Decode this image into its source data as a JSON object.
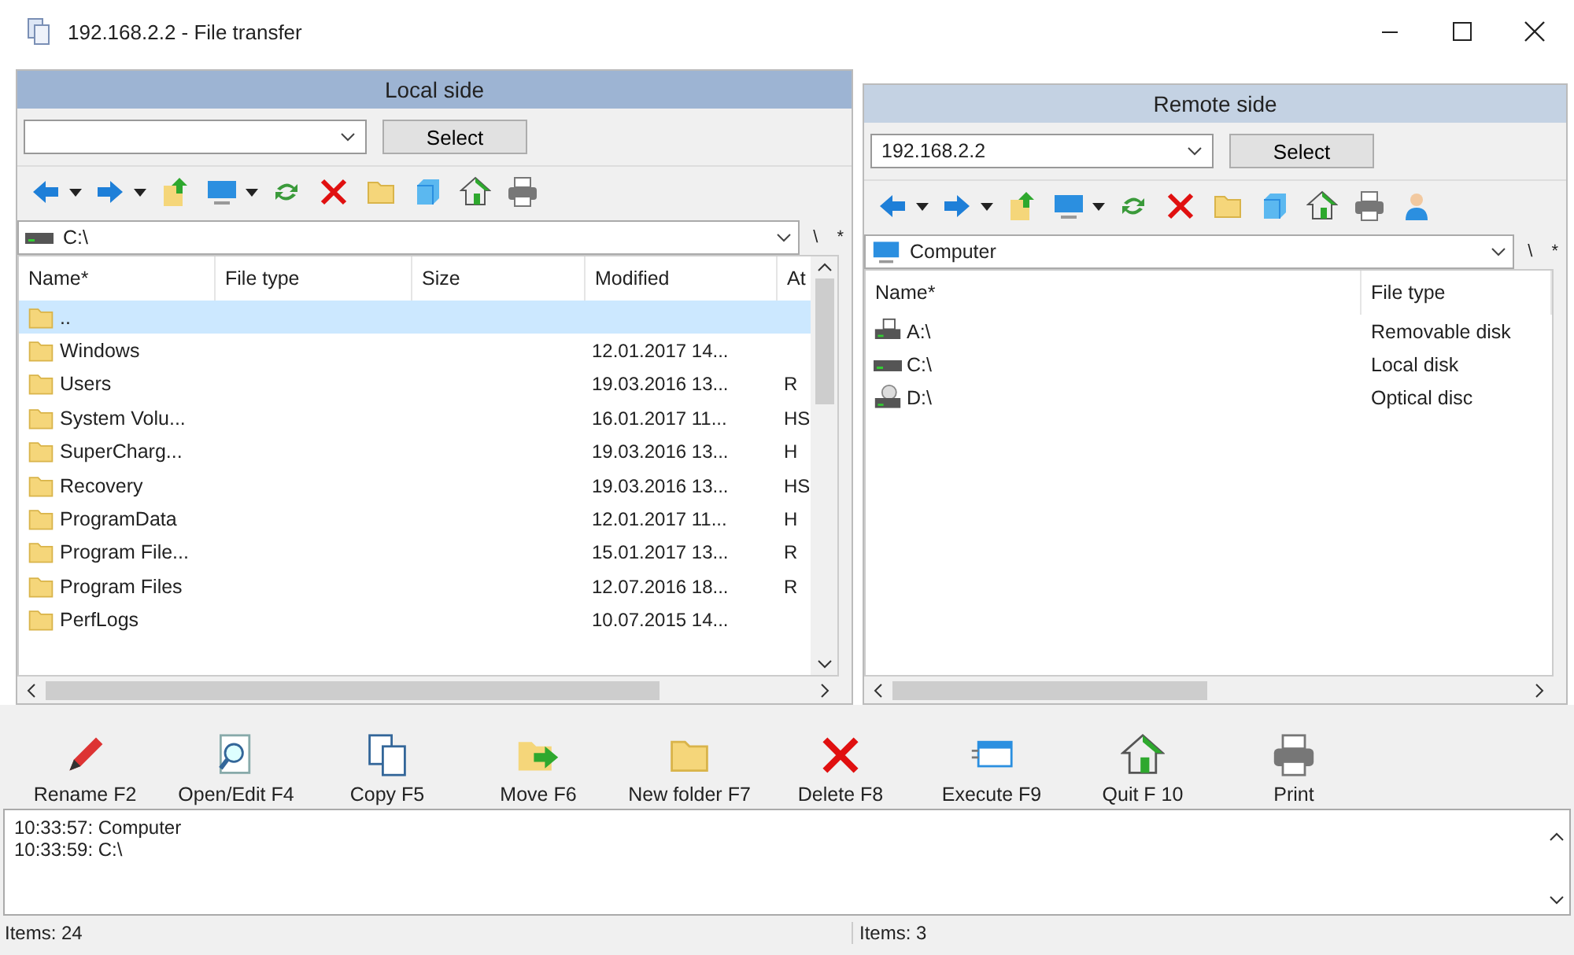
{
  "window": {
    "title": "192.168.2.2 - File transfer"
  },
  "panes": [
    {
      "title": "Local side",
      "active": true,
      "select_button": "Select",
      "tools": [
        {
          "kind": "back"
        },
        {
          "kind": "forward"
        },
        {
          "kind": "up"
        },
        {
          "kind": "monitor"
        },
        {
          "kind": "refresh"
        },
        {
          "kind": "delete"
        },
        {
          "kind": "folder"
        },
        {
          "kind": "cube"
        },
        {
          "kind": "home"
        },
        {
          "kind": "printer"
        }
      ],
      "path": "C:\\",
      "path_icon": {
        "kind": "drive"
      },
      "path_buttons": [
        "\\",
        "*"
      ],
      "columns": [
        "Name*",
        "File type",
        "Size",
        "Modified",
        "At"
      ],
      "rows": [
        {
          "name": "..",
          "modified": "",
          "attributes": "",
          "selected": true
        },
        {
          "name": "Windows",
          "modified": "12.01.2017 14...",
          "attributes": "",
          "selected": false
        },
        {
          "name": "Users",
          "modified": "19.03.2016 13...",
          "attributes": "R",
          "selected": false
        },
        {
          "name": "System Volu...",
          "modified": "16.01.2017 11...",
          "attributes": "HS",
          "selected": false
        },
        {
          "name": "SuperCharg...",
          "modified": "19.03.2016 13...",
          "attributes": "H",
          "selected": false
        },
        {
          "name": "Recovery",
          "modified": "19.03.2016 13...",
          "attributes": "HS",
          "selected": false
        },
        {
          "name": "ProgramData",
          "modified": "12.01.2017 11...",
          "attributes": "H",
          "selected": false
        },
        {
          "name": "Program File...",
          "modified": "15.01.2017 13...",
          "attributes": "R",
          "selected": false
        },
        {
          "name": "Program Files",
          "modified": "12.07.2016 18...",
          "attributes": "R",
          "selected": false
        },
        {
          "name": "PerfLogs",
          "modified": "10.07.2015 14...",
          "attributes": "",
          "selected": false
        }
      ],
      "status": "Items: 24"
    },
    {
      "title": "Remote side",
      "active": false,
      "host": "192.168.2.2",
      "select_button": "Select",
      "tools": [
        {
          "kind": "back"
        },
        {
          "kind": "forward"
        },
        {
          "kind": "up"
        },
        {
          "kind": "monitor"
        },
        {
          "kind": "refresh"
        },
        {
          "kind": "delete"
        },
        {
          "kind": "folder"
        },
        {
          "kind": "cube"
        },
        {
          "kind": "home"
        },
        {
          "kind": "printer"
        },
        {
          "kind": "user"
        }
      ],
      "path": "Computer",
      "path_icon": {
        "kind": "monitor"
      },
      "path_buttons": [
        "\\",
        "*"
      ],
      "columns": [
        "Name*",
        "File type"
      ],
      "rows": [
        {
          "name": "A:\\",
          "kind": "floppy",
          "file_type": "Removable disk"
        },
        {
          "name": "C:\\",
          "kind": "drive",
          "file_type": "Local disk"
        },
        {
          "name": "D:\\",
          "kind": "optical",
          "file_type": "Optical disc"
        }
      ],
      "status": "Items: 3"
    }
  ],
  "actions": [
    {
      "label": "Rename F2",
      "kind": "pencil"
    },
    {
      "label": "Open/Edit F4",
      "kind": "magnifier"
    },
    {
      "label": "Copy F5",
      "kind": "copy"
    },
    {
      "label": "Move F6",
      "kind": "move"
    },
    {
      "label": "New folder F7",
      "kind": "folder"
    },
    {
      "label": "Delete F8",
      "kind": "delete"
    },
    {
      "label": "Execute F9",
      "kind": "execute"
    },
    {
      "label": "Quit F 10",
      "kind": "home"
    },
    {
      "label": "Print",
      "kind": "printer"
    }
  ],
  "log": [
    "10:33:57: Computer",
    "10:33:59: C:\\"
  ]
}
